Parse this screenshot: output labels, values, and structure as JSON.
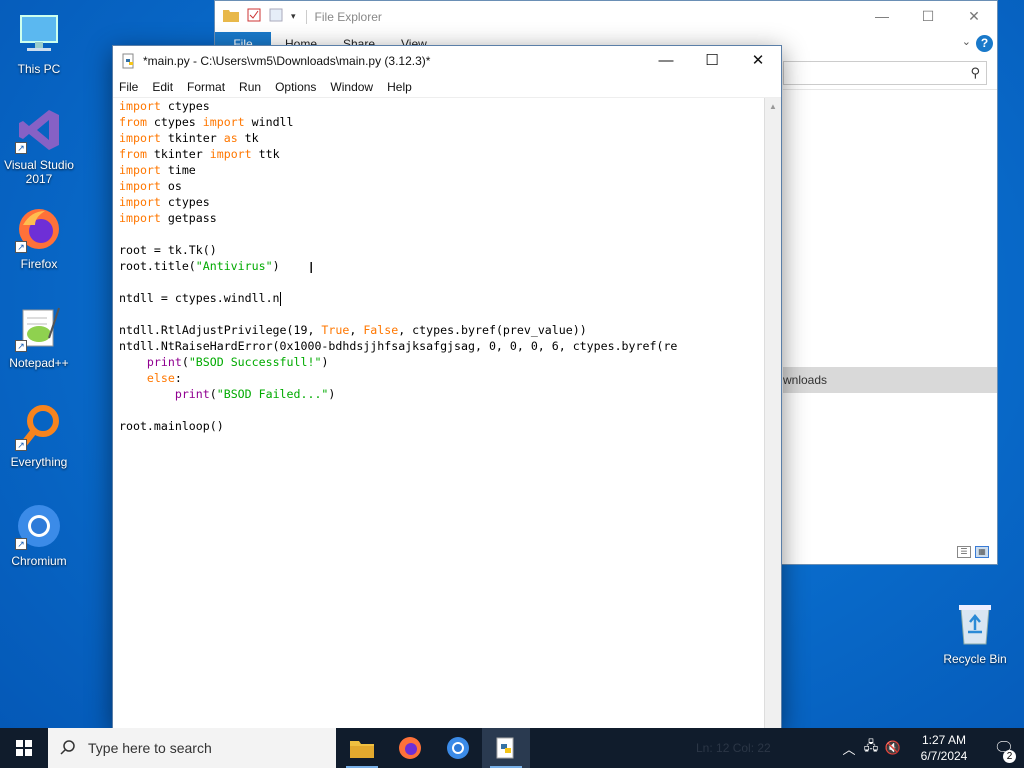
{
  "desktop": {
    "icons": [
      {
        "label": "This PC"
      },
      {
        "label": "Visual Studio 2017"
      },
      {
        "label": "Firefox"
      },
      {
        "label": "Notepad++"
      },
      {
        "label": "Everything"
      },
      {
        "label": "Chromium"
      },
      {
        "label": "Recycle Bin"
      }
    ]
  },
  "explorer": {
    "title": "File Explorer",
    "ribbon_tabs": [
      "File",
      "Home",
      "Share",
      "View"
    ],
    "nav_downloads": "wnloads",
    "help_glyph": "?"
  },
  "idle": {
    "title": "*main.py - C:\\Users\\vm5\\Downloads\\main.py (3.12.3)*",
    "menu": [
      "File",
      "Edit",
      "Format",
      "Run",
      "Options",
      "Window",
      "Help"
    ]
  },
  "taskbar": {
    "search_placeholder": "Type here to search",
    "status_ghost": "Ln: 12   Col: 22",
    "time": "1:27 AM",
    "date": "6/7/2024",
    "notification_count": "2"
  },
  "colors": {
    "keyword": "#ff7700",
    "string": "#00aa00",
    "builtin": "#900090",
    "accent": "#1979ca"
  }
}
